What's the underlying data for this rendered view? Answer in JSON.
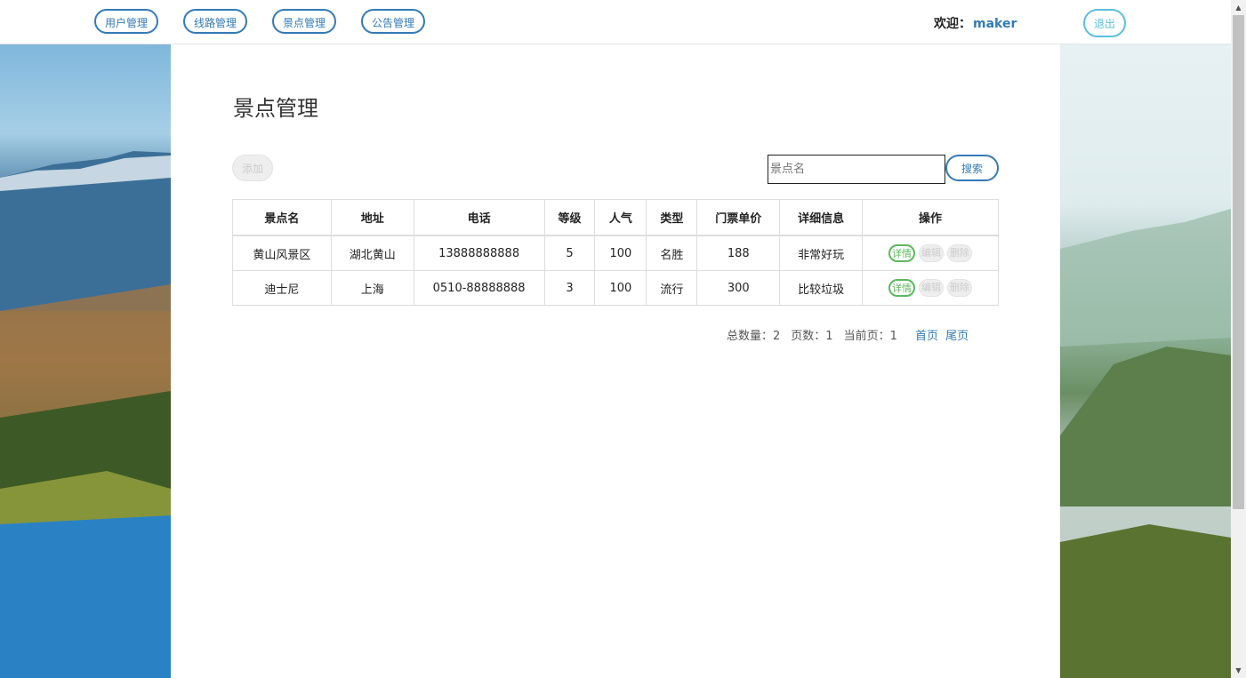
{
  "nav": {
    "items": [
      "用户管理",
      "线路管理",
      "景点管理",
      "公告管理"
    ],
    "welcome_label": "欢迎：",
    "username": "maker",
    "logout_label": "退出"
  },
  "page": {
    "title": "景点管理",
    "add_label": "添加",
    "search_placeholder": "景点名",
    "search_label": "搜索"
  },
  "table": {
    "headers": [
      "景点名",
      "地址",
      "电话",
      "等级",
      "人气",
      "类型",
      "门票单价",
      "详细信息",
      "操作"
    ],
    "rows": [
      [
        "黄山风景区",
        "湖北黄山",
        "13888888888",
        "5",
        "100",
        "名胜",
        "188",
        "非常好玩"
      ],
      [
        "迪士尼",
        "上海",
        "0510-88888888",
        "3",
        "100",
        "流行",
        "300",
        "比较垃圾"
      ]
    ],
    "actions": {
      "detail": "详情",
      "edit": "编辑",
      "delete": "删除"
    }
  },
  "pager": {
    "total_label": "总数量：2",
    "pages_label": "页数：1",
    "current_label": "当前页：1",
    "first_label": "首页",
    "last_label": "尾页"
  },
  "colors": {
    "primary": "#337ab7",
    "info": "#5bc0de",
    "success": "#5cb85c"
  }
}
